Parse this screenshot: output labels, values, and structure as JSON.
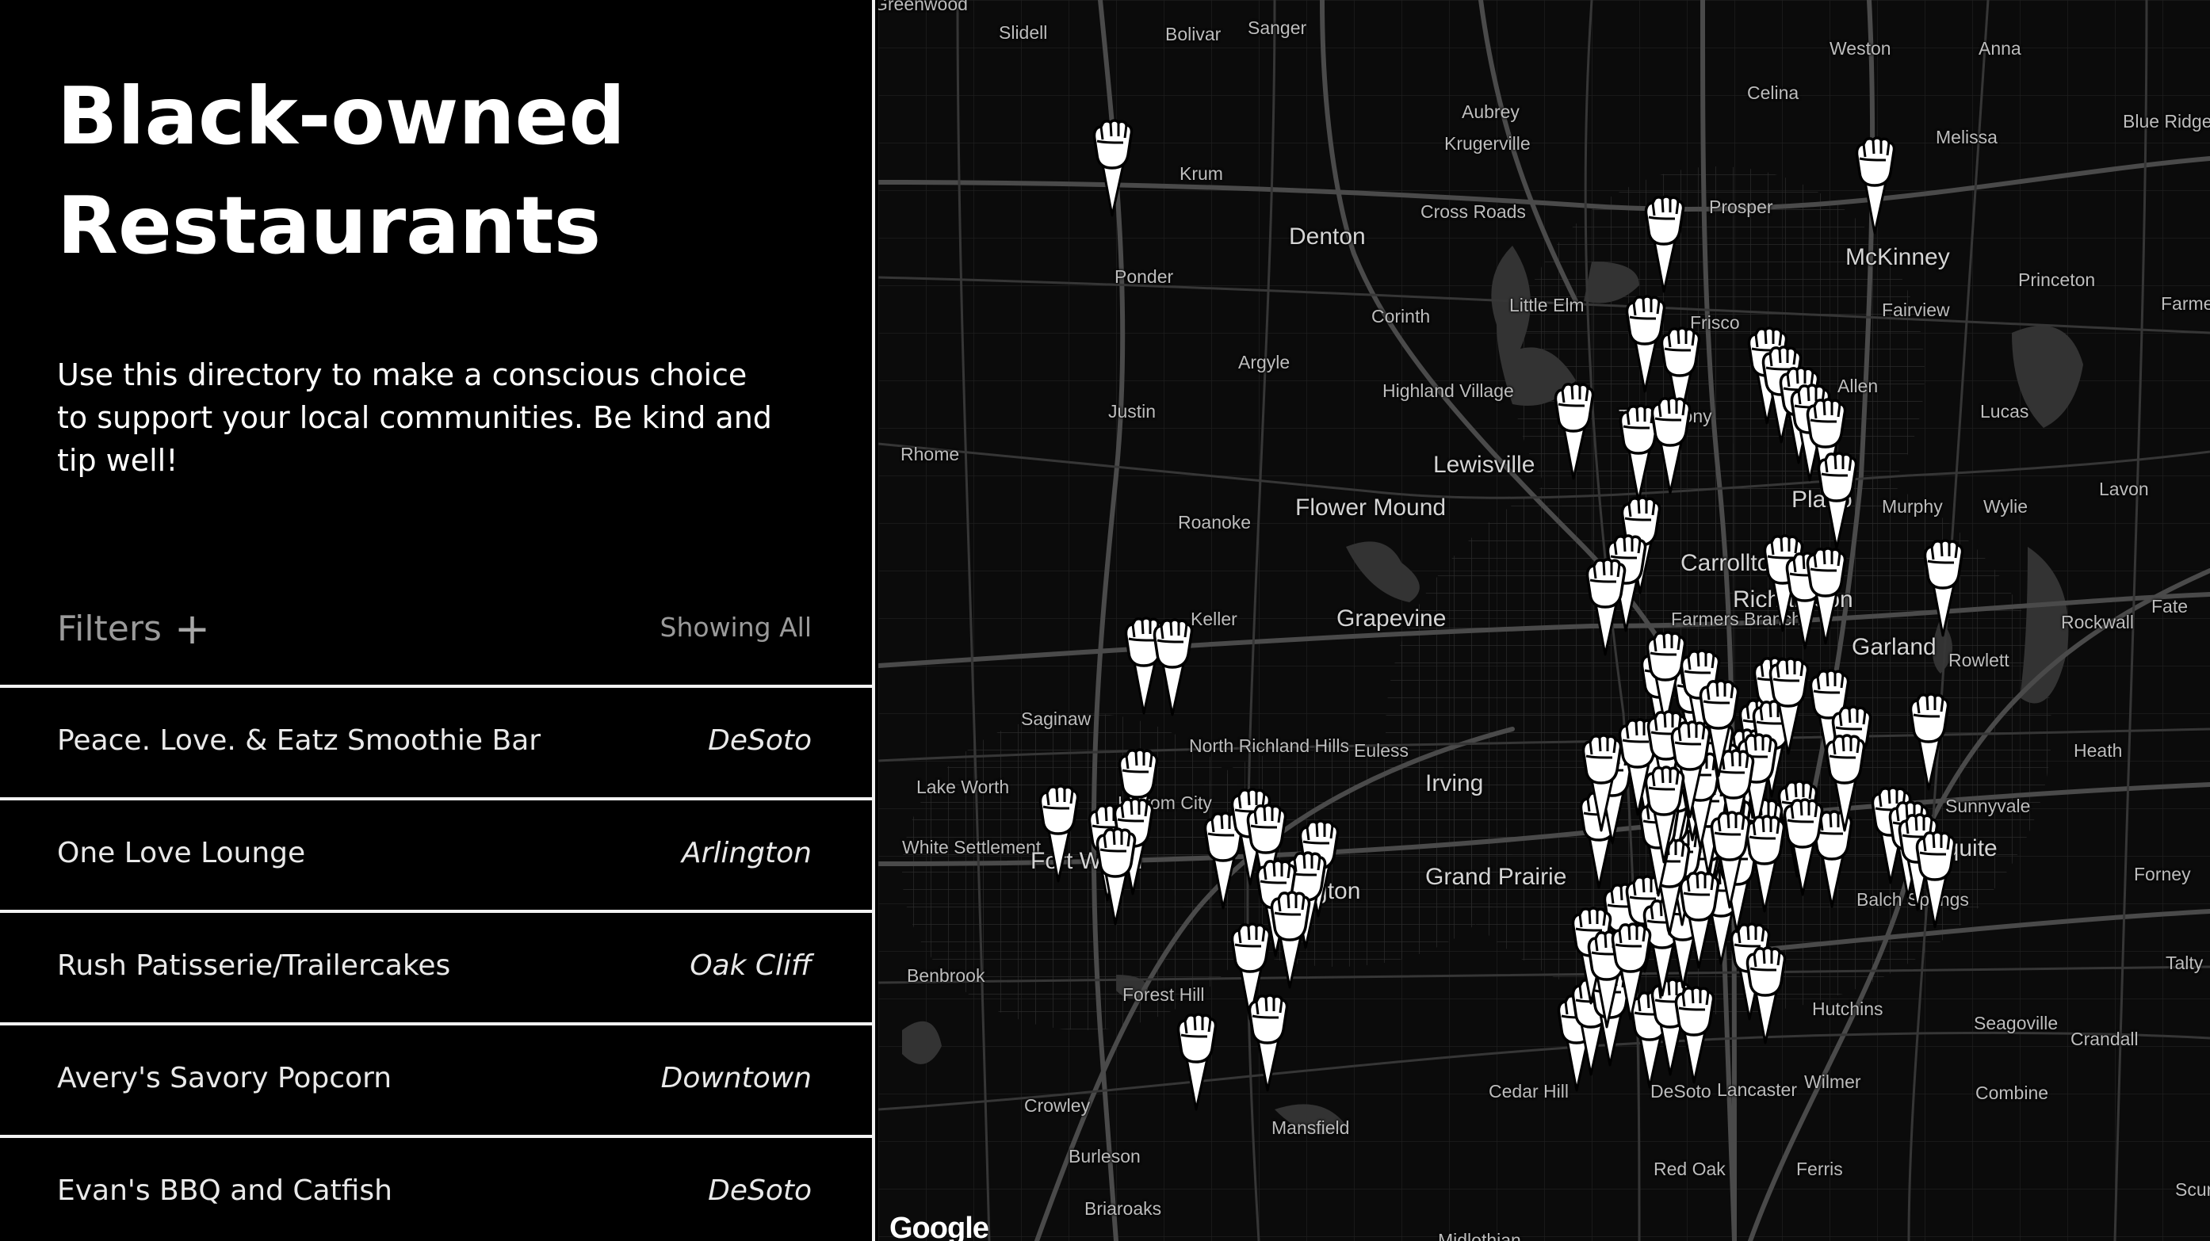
{
  "sidebar": {
    "title": "Black-owned Restaurants",
    "description": "Use this directory to make a conscious choice to support your local communities. Be kind and tip well!",
    "filters_label": "Filters",
    "filters_icon": "plus-icon",
    "showing_label": "Showing All",
    "restaurants": [
      {
        "name": "Peace. Love. & Eatz Smoothie Bar",
        "area": "DeSoto"
      },
      {
        "name": "One Love Lounge",
        "area": "Arlington"
      },
      {
        "name": "Rush Patisserie/Trailercakes",
        "area": "Oak Cliff"
      },
      {
        "name": "Avery's Savory Popcorn",
        "area": "Downtown"
      },
      {
        "name": "Evan's BBQ and Catfish",
        "area": "DeSoto"
      }
    ]
  },
  "map": {
    "theme": "dark",
    "attribution": "Google",
    "marker_icon": "raised-fist-icon",
    "cities": [
      {
        "name": "Greenwood"
      },
      {
        "name": "Slidell"
      },
      {
        "name": "Bolivar"
      },
      {
        "name": "Sanger"
      },
      {
        "name": "Weston"
      },
      {
        "name": "Anna"
      },
      {
        "name": "Celina"
      },
      {
        "name": "Blue Ridge"
      },
      {
        "name": "Aubrey"
      },
      {
        "name": "Krugerville"
      },
      {
        "name": "Melissa"
      },
      {
        "name": "Krum"
      },
      {
        "name": "Cross Roads"
      },
      {
        "name": "Prosper"
      },
      {
        "name": "Denton"
      },
      {
        "name": "McKinney"
      },
      {
        "name": "Ponder"
      },
      {
        "name": "Little Elm"
      },
      {
        "name": "Princeton"
      },
      {
        "name": "Corinth"
      },
      {
        "name": "Fairview"
      },
      {
        "name": "Farmersville"
      },
      {
        "name": "Frisco"
      },
      {
        "name": "Argyle"
      },
      {
        "name": "Highland Village"
      },
      {
        "name": "Allen"
      },
      {
        "name": "Justin"
      },
      {
        "name": "The Colony"
      },
      {
        "name": "Lucas"
      },
      {
        "name": "Rhome"
      },
      {
        "name": "Lewisville"
      },
      {
        "name": "Lavon"
      },
      {
        "name": "Flower Mound"
      },
      {
        "name": "Plano"
      },
      {
        "name": "Murphy"
      },
      {
        "name": "Wylie"
      },
      {
        "name": "Roanoke"
      },
      {
        "name": "Carrollton"
      },
      {
        "name": "Richardson"
      },
      {
        "name": "Keller"
      },
      {
        "name": "Grapevine"
      },
      {
        "name": "Farmers Branch"
      },
      {
        "name": "Garland"
      },
      {
        "name": "Rockwall"
      },
      {
        "name": "Fate"
      },
      {
        "name": "Rowlett"
      },
      {
        "name": "Saginaw"
      },
      {
        "name": "North Richland Hills"
      },
      {
        "name": "Euless"
      },
      {
        "name": "Heath"
      },
      {
        "name": "Irving"
      },
      {
        "name": "Lake Worth"
      },
      {
        "name": "Haltom City"
      },
      {
        "name": "Sunnyvale"
      },
      {
        "name": "White Settlement"
      },
      {
        "name": "Fort Worth"
      },
      {
        "name": "Mesquite"
      },
      {
        "name": "Grand Prairie"
      },
      {
        "name": "Arlington"
      },
      {
        "name": "Forney"
      },
      {
        "name": "Balch Springs"
      },
      {
        "name": "Benbrook"
      },
      {
        "name": "Talty"
      },
      {
        "name": "Forest Hill"
      },
      {
        "name": "Hutchins"
      },
      {
        "name": "Seagoville"
      },
      {
        "name": "Crandall"
      },
      {
        "name": "Cedar Hill"
      },
      {
        "name": "DeSoto"
      },
      {
        "name": "Lancaster"
      },
      {
        "name": "Wilmer"
      },
      {
        "name": "Combine"
      },
      {
        "name": "Crowley"
      },
      {
        "name": "Mansfield"
      },
      {
        "name": "Burleson"
      },
      {
        "name": "Red Oak"
      },
      {
        "name": "Ferris"
      },
      {
        "name": "Scurry"
      },
      {
        "name": "Briaroaks"
      },
      {
        "name": "Midlothian"
      }
    ]
  }
}
